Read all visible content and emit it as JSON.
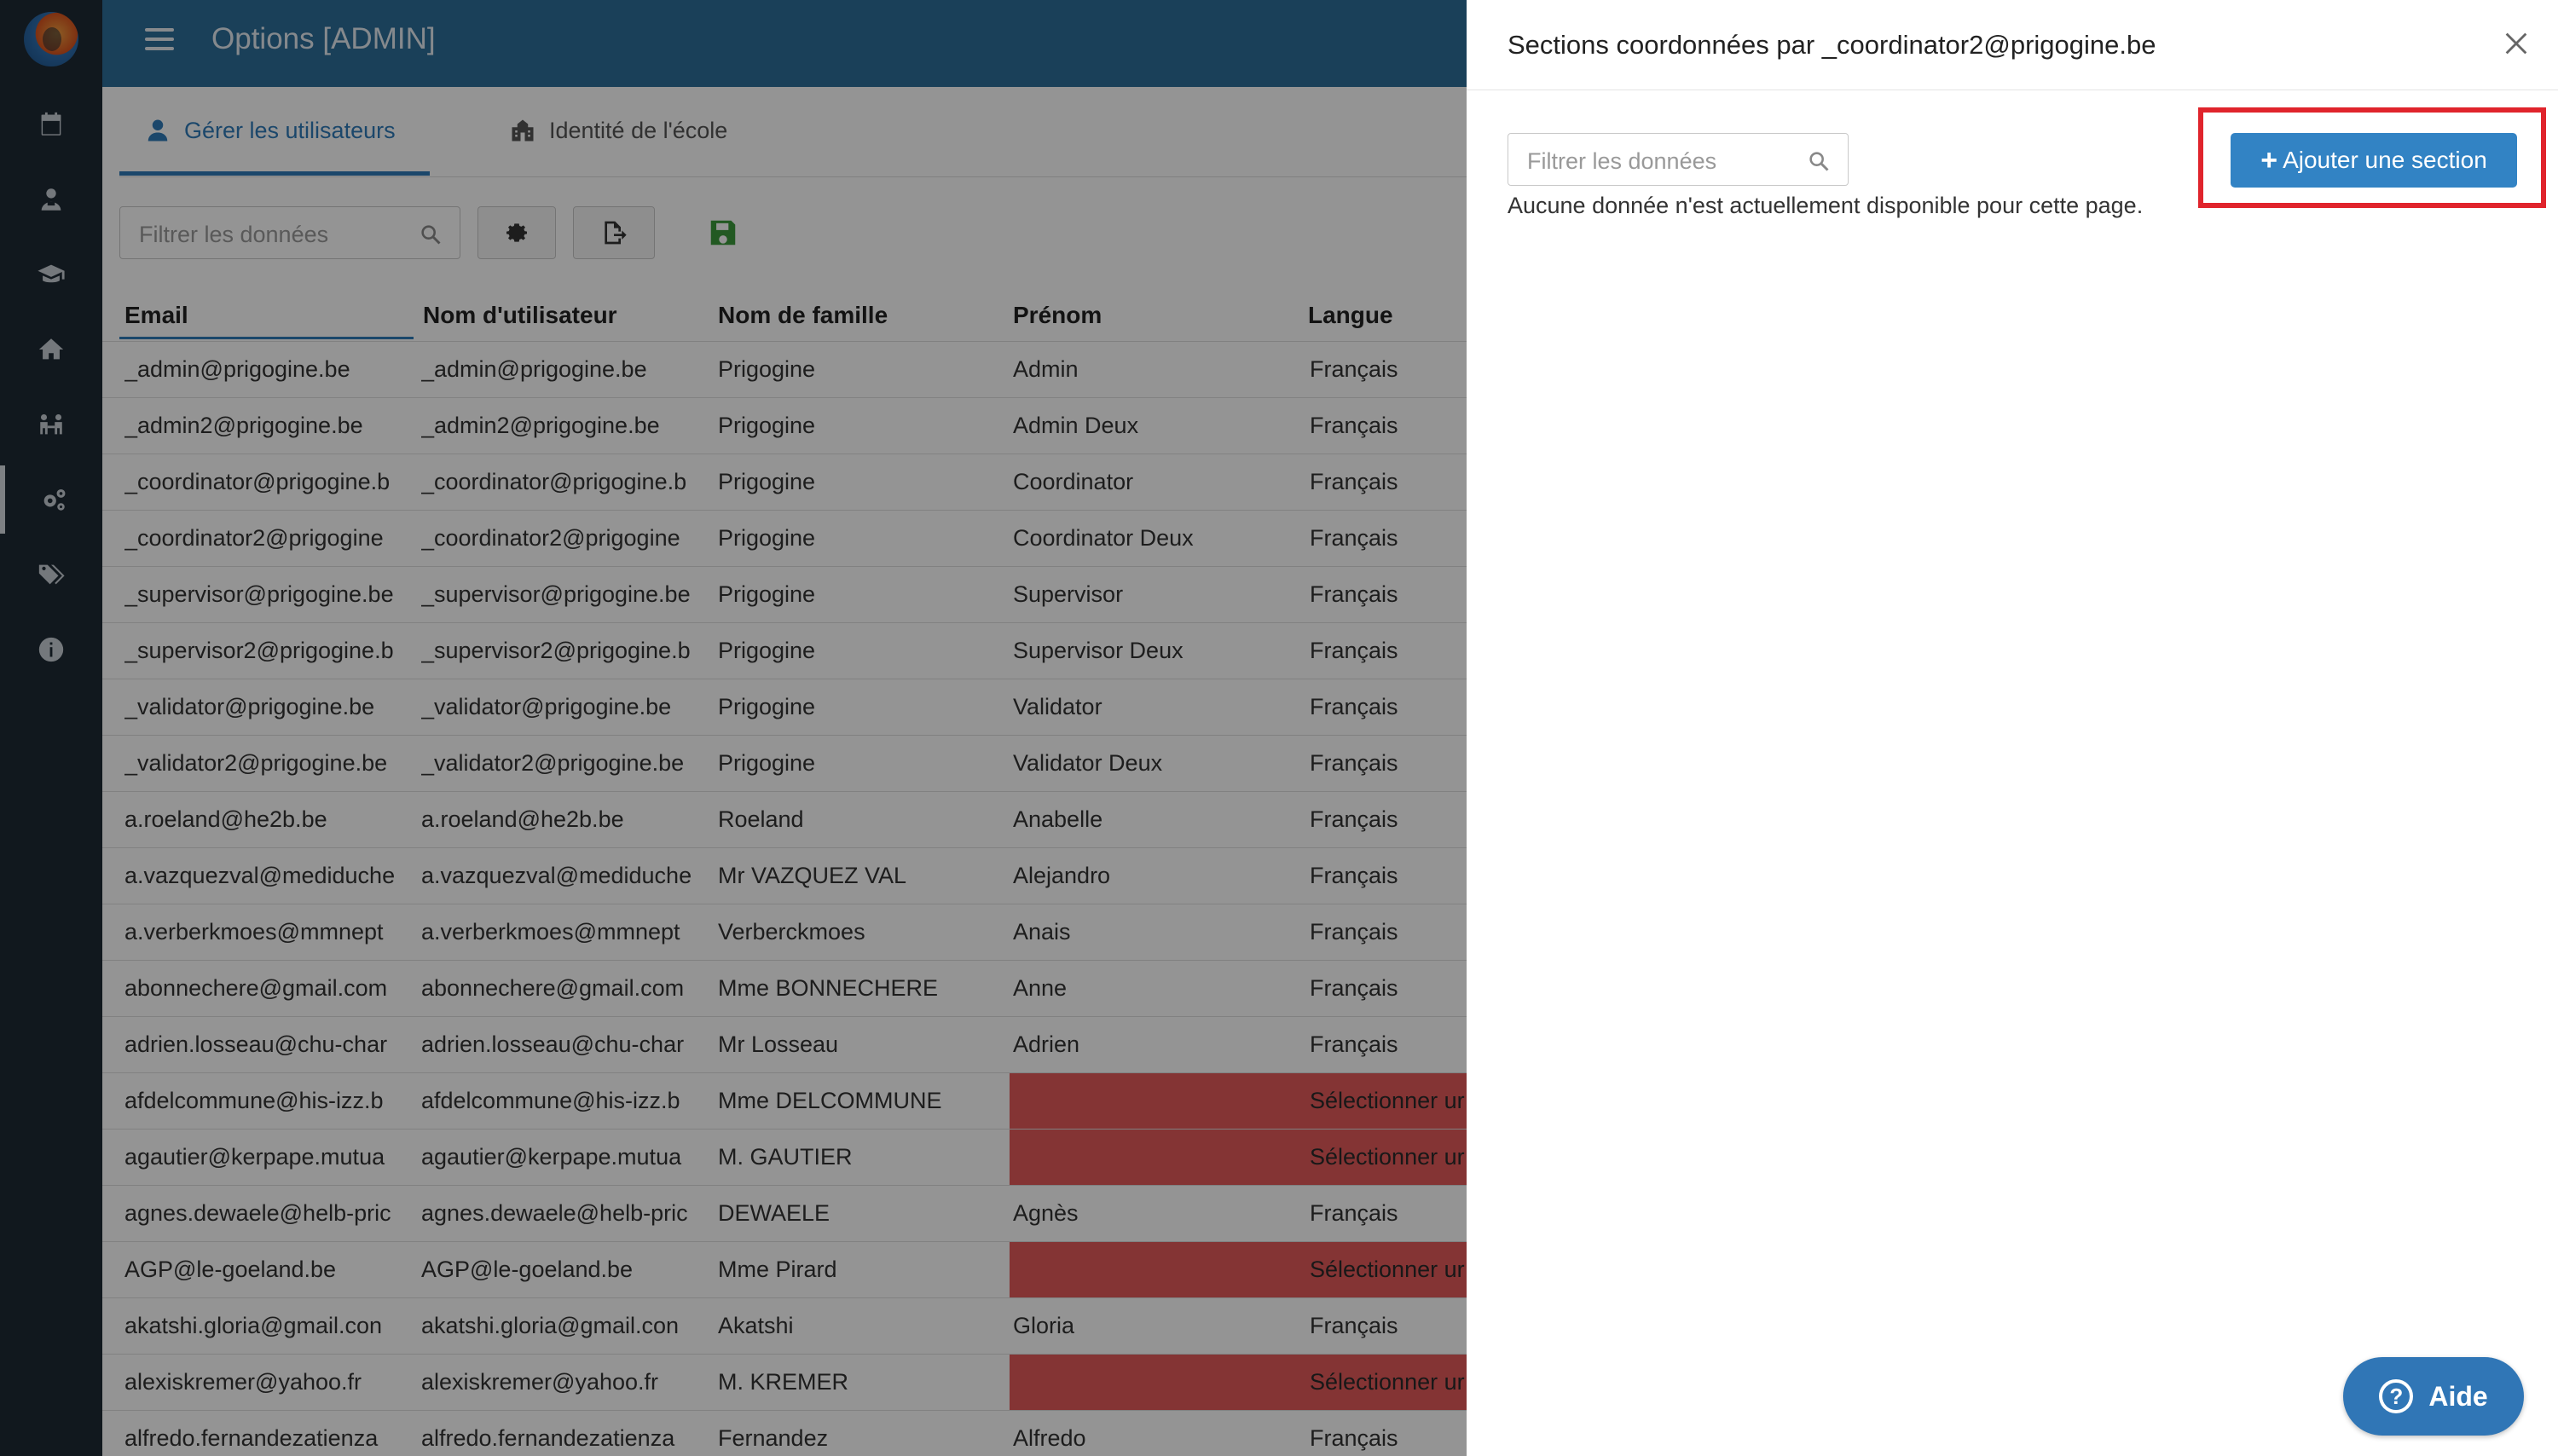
{
  "app": {
    "title": "Options [ADMIN]"
  },
  "sidebar": {
    "items": [
      {
        "icon": "calendar-icon"
      },
      {
        "icon": "teacher-icon"
      },
      {
        "icon": "graduation-cap-icon"
      },
      {
        "icon": "home-icon"
      },
      {
        "icon": "users-icon"
      },
      {
        "icon": "settings-icon",
        "active": true
      },
      {
        "icon": "tags-icon"
      },
      {
        "icon": "info-icon"
      }
    ]
  },
  "tabs": [
    {
      "label": "Gérer les utilisateurs",
      "active": true
    },
    {
      "label": "Identité de l'école",
      "active": false
    }
  ],
  "toolbar": {
    "filter_placeholder": "Filtrer les données"
  },
  "table": {
    "columns": [
      "Email",
      "Nom d'utilisateur",
      "Nom de famille",
      "Prénom",
      "Langue"
    ],
    "rows": [
      [
        "_admin@prigogine.be",
        "_admin@prigogine.be",
        "Prigogine",
        "Admin",
        "Français"
      ],
      [
        "_admin2@prigogine.be",
        "_admin2@prigogine.be",
        "Prigogine",
        "Admin Deux",
        "Français"
      ],
      [
        "_coordinator@prigogine.b",
        "_coordinator@prigogine.b",
        "Prigogine",
        "Coordinator",
        "Français"
      ],
      [
        "_coordinator2@prigogine",
        "_coordinator2@prigogine",
        "Prigogine",
        "Coordinator Deux",
        "Français"
      ],
      [
        "_supervisor@prigogine.be",
        "_supervisor@prigogine.be",
        "Prigogine",
        "Supervisor",
        "Français"
      ],
      [
        "_supervisor2@prigogine.b",
        "_supervisor2@prigogine.b",
        "Prigogine",
        "Supervisor Deux",
        "Français"
      ],
      [
        "_validator@prigogine.be",
        "_validator@prigogine.be",
        "Prigogine",
        "Validator",
        "Français"
      ],
      [
        "_validator2@prigogine.be",
        "_validator2@prigogine.be",
        "Prigogine",
        "Validator Deux",
        "Français"
      ],
      [
        "a.roeland@he2b.be",
        "a.roeland@he2b.be",
        "Roeland",
        "Anabelle",
        "Français"
      ],
      [
        "a.vazquezval@mediduche",
        "a.vazquezval@mediduche",
        "Mr VAZQUEZ VAL",
        "Alejandro",
        "Français"
      ],
      [
        "a.verberkmoes@mmnept",
        "a.verberkmoes@mmnept",
        "Verberckmoes",
        "Anais",
        "Français"
      ],
      [
        "abonnechere@gmail.com",
        "abonnechere@gmail.com",
        "Mme BONNECHERE",
        "Anne",
        "Français"
      ],
      [
        "adrien.losseau@chu-char",
        "adrien.losseau@chu-char",
        "Mr Losseau",
        "Adrien",
        "Français"
      ],
      [
        "afdelcommune@his-izz.b",
        "afdelcommune@his-izz.b",
        "Mme DELCOMMUNE",
        "",
        "Sélectionner ur"
      ],
      [
        "agautier@kerpape.mutua",
        "agautier@kerpape.mutua",
        "M. GAUTIER",
        "",
        "Sélectionner ur"
      ],
      [
        "agnes.dewaele@helb-pric",
        "agnes.dewaele@helb-pric",
        "DEWAELE",
        "Agnès",
        "Français"
      ],
      [
        "AGP@le-goeland.be",
        "AGP@le-goeland.be",
        "Mme Pirard",
        "",
        "Sélectionner ur"
      ],
      [
        "akatshi.gloria@gmail.con",
        "akatshi.gloria@gmail.con",
        "Akatshi",
        "Gloria",
        "Français"
      ],
      [
        "alexiskremer@yahoo.fr",
        "alexiskremer@yahoo.fr",
        "M. KREMER",
        "",
        "Sélectionner ur"
      ],
      [
        "alfredo.fernandezatienza",
        "alfredo.fernandezatienza",
        "Fernandez",
        "Alfredo",
        "Français"
      ]
    ]
  },
  "panel": {
    "title": "Sections coordonnées par _coordinator2@prigogine.be",
    "filter_placeholder": "Filtrer les données",
    "empty_message": "Aucune donnée n'est actuellement disponible pour cette page.",
    "add_button": "Ajouter une section",
    "highlight_color": "#e0242c"
  },
  "help": {
    "label": "Aide"
  },
  "colors": {
    "topbar": "#2e6f99",
    "accent": "#3283c4",
    "sidebar": "#1e2a35",
    "missing": "#e35b5b"
  }
}
